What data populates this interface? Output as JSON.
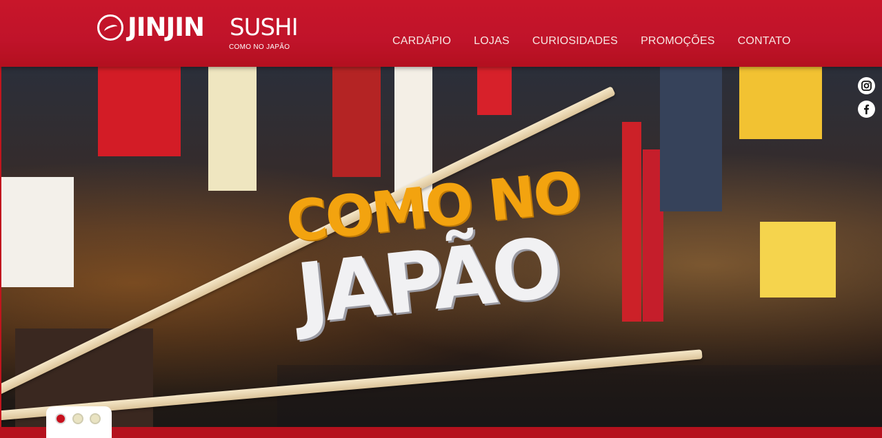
{
  "logo": {
    "brand_primary": "JINJIN",
    "brand_secondary": "SUSHI",
    "tagline": "COMO NO JAPÃO"
  },
  "nav": {
    "items": [
      {
        "label": "CARDÁPIO"
      },
      {
        "label": "LOJAS"
      },
      {
        "label": "CURIOSIDADES"
      },
      {
        "label": "PROMOÇÕES"
      },
      {
        "label": "CONTATO"
      }
    ]
  },
  "hero": {
    "headline_line1": "COMO NO",
    "headline_line2": "JAPÃO"
  },
  "social": {
    "instagram_icon": "instagram-icon",
    "facebook_icon": "facebook-icon"
  },
  "slider": {
    "active_index": 0,
    "count": 3
  },
  "colors": {
    "brand_red": "#c8162a",
    "headline_orange": "#f3a30f",
    "headline_white": "#f1f1f3"
  }
}
